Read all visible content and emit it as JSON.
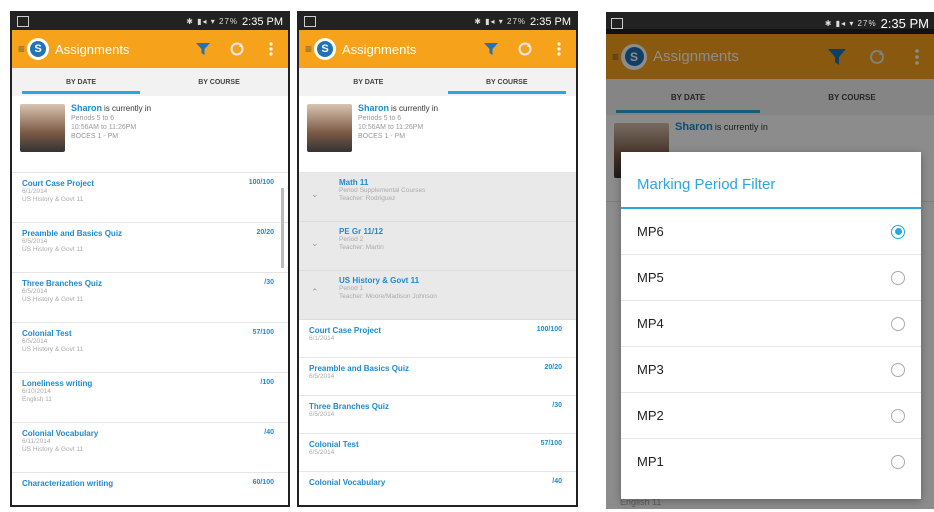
{
  "status": {
    "time": "2:35 PM",
    "icons": "✱ ▮◂ ▾ 27%"
  },
  "app": {
    "title": "Assignments",
    "logo_letter": "S"
  },
  "tabs": {
    "by_date": "BY DATE",
    "by_course": "BY COURSE"
  },
  "student": {
    "name": "Sharon",
    "status_suffix": "is currently in",
    "line1": "Periods 5 to 6",
    "line2": "10:56AM to 11:26PM",
    "line3": "BOCES 1 - PM"
  },
  "screen1": {
    "assignments": [
      {
        "name": "Court Case Project",
        "date": "6/1/2014",
        "course": "US History & Govt 11",
        "score": "100/100"
      },
      {
        "name": "Preamble and Basics Quiz",
        "date": "6/5/2014",
        "course": "US History & Govt 11",
        "score": "20/20"
      },
      {
        "name": "Three Branches Quiz",
        "date": "6/5/2014",
        "course": "US History & Govt 11",
        "score": "/30"
      },
      {
        "name": "Colonial Test",
        "date": "6/5/2014",
        "course": "US History & Govt 11",
        "score": "57/100"
      },
      {
        "name": "Loneliness writing",
        "date": "6/10/2014",
        "course": "English 11",
        "score": "/100"
      },
      {
        "name": "Colonial Vocabulary",
        "date": "6/11/2014",
        "course": "US History & Govt 11",
        "score": "/40"
      },
      {
        "name": "Characterization writing",
        "date": "",
        "course": "",
        "score": "60/100"
      }
    ]
  },
  "screen2": {
    "courses": [
      {
        "name": "Math 11",
        "period": "Period Supplemental Courses",
        "teacher": "Teacher: Rodriguez",
        "chevron": "⌄"
      },
      {
        "name": "PE Gr 11/12",
        "period": "Period 2",
        "teacher": "Teacher: Martin",
        "chevron": "⌄"
      },
      {
        "name": "US History & Govt 11",
        "period": "Period 1",
        "teacher": "Teacher: Moore/Madison Johnson",
        "chevron": "⌃"
      }
    ],
    "assignments": [
      {
        "name": "Court Case Project",
        "date": "6/1/2014",
        "score": "100/100"
      },
      {
        "name": "Preamble and Basics Quiz",
        "date": "6/5/2014",
        "score": "20/20"
      },
      {
        "name": "Three Branches Quiz",
        "date": "6/5/2014",
        "score": "/30"
      },
      {
        "name": "Colonial Test",
        "date": "6/5/2014",
        "score": "57/100"
      },
      {
        "name": "Colonial Vocabulary",
        "date": "",
        "score": "/40"
      }
    ]
  },
  "dialog": {
    "title": "Marking Period Filter",
    "options": [
      {
        "label": "MP6",
        "selected": true
      },
      {
        "label": "MP5",
        "selected": false
      },
      {
        "label": "MP4",
        "selected": false
      },
      {
        "label": "MP3",
        "selected": false
      },
      {
        "label": "MP2",
        "selected": false
      },
      {
        "label": "MP1",
        "selected": false
      }
    ],
    "behind_text": "English 11"
  },
  "colors": {
    "accent": "#f7a21b",
    "link": "#1e8ad0",
    "tab_indicator": "#2aa6e0"
  }
}
